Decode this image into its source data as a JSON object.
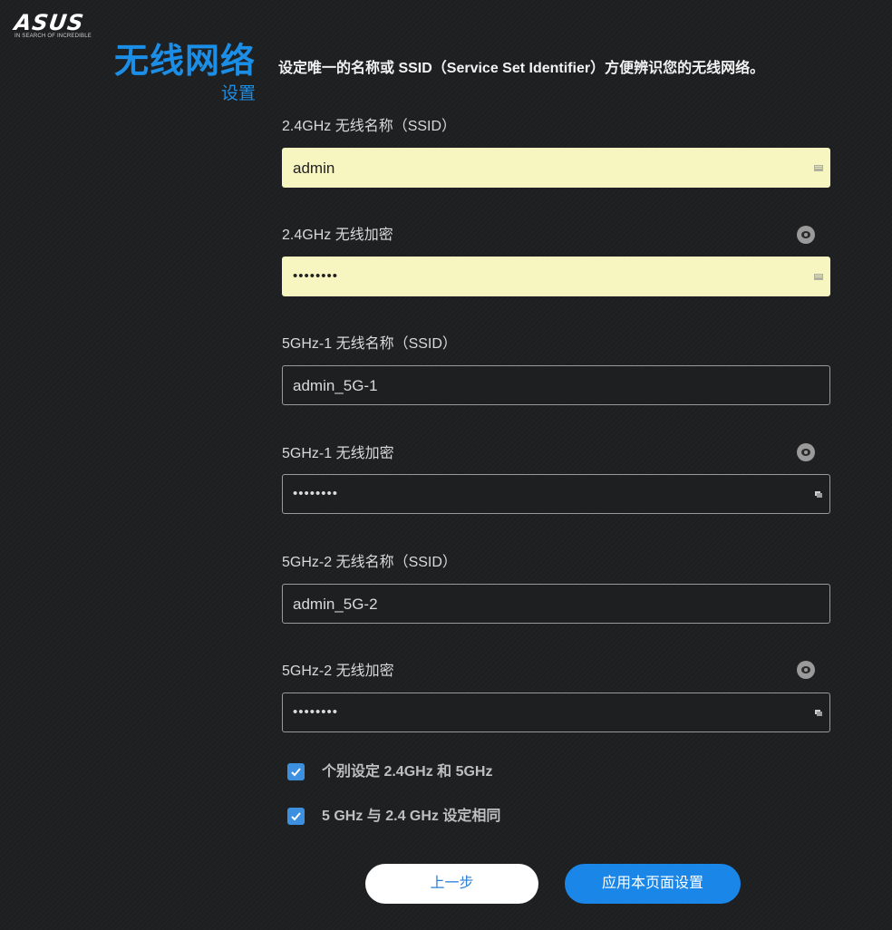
{
  "brand": {
    "logo_text": "ASUS",
    "tagline": "IN SEARCH OF INCREDIBLE"
  },
  "header": {
    "title": "无线网络",
    "subtitle": "设置",
    "description": "设定唯一的名称或 SSID（Service Set Identifier）方便辨识您的无线网络。"
  },
  "fields": [
    {
      "label": "2.4GHz 无线名称（SSID）",
      "value": "admin",
      "autofill": true
    },
    {
      "label": "2.4GHz 无线加密",
      "value": "••••••••",
      "autofill": true,
      "password": true
    },
    {
      "label": "5GHz-1 无线名称（SSID）",
      "value": "admin_5G-1"
    },
    {
      "label": "5GHz-1 无线加密",
      "value": "••••••••",
      "password": true
    },
    {
      "label": "5GHz-2 无线名称（SSID）",
      "value": "admin_5G-2"
    },
    {
      "label": "5GHz-2 无线加密",
      "value": "••••••••",
      "password": true
    }
  ],
  "options": [
    {
      "label": "个别设定 2.4GHz 和 5GHz",
      "checked": true
    },
    {
      "label": "5 GHz 与 2.4 GHz 设定相同",
      "checked": true
    }
  ],
  "buttons": {
    "back": "上一步",
    "apply": "应用本页面设置"
  },
  "colors": {
    "accent": "#1b8fe8",
    "background": "#1e1f21",
    "autofill": "#f8f6c0",
    "checkbox": "#3d8fe0"
  },
  "icons": {
    "password_toggle": "eye-icon",
    "checkbox": "checkmark-icon",
    "field_helper": "keyboard-icon"
  }
}
